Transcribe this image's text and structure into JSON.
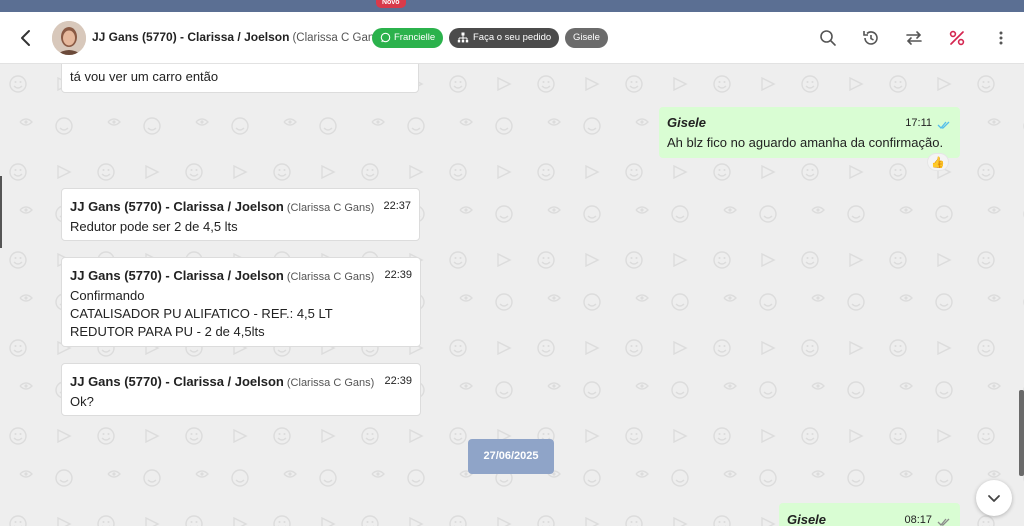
{
  "top_badge": "Novo",
  "header": {
    "contact_name": "JJ Gans (5770) - Clarissa / Joelson",
    "contact_sub": "(Clarissa C Gans)",
    "chips": {
      "whatsapp": "Francielle",
      "order": "Faça o seu pedido",
      "agent": "Gisele"
    },
    "icons": [
      "search-icon",
      "history-icon",
      "transfer-icon",
      "percent-icon",
      "more-vertical-icon"
    ]
  },
  "messages": {
    "m0": {
      "body": "tá vou ver um carro então"
    },
    "m1": {
      "sender": "Gisele",
      "time": "17:11",
      "body": "Ah blz fico no aguardo amanha da confirmação.",
      "reaction": "👍"
    },
    "m2": {
      "sender": "JJ Gans (5770) - Clarissa / Joelson",
      "sender_sub": "(Clarissa C Gans)",
      "time": "22:37",
      "body": "Redutor pode ser 2 de 4,5 lts"
    },
    "m3": {
      "sender": "JJ Gans (5770) - Clarissa / Joelson",
      "sender_sub": "(Clarissa C Gans)",
      "time": "22:39",
      "lines": [
        "Confirmando",
        "CATALISADOR PU ALIFATICO - REF.: 4,5 LT",
        "REDUTOR PARA PU - 2 de 4,5lts"
      ]
    },
    "m4": {
      "sender": "JJ Gans (5770) - Clarissa / Joelson",
      "sender_sub": "(Clarissa C Gans)",
      "time": "22:39",
      "body": "Ok?"
    },
    "date_separator": "27/06/2025",
    "m5": {
      "sender": "Gisele",
      "time": "08:17"
    }
  },
  "colors": {
    "outgoing_bubble": "#d9fdd3",
    "whatsapp_green": "#2bb24c",
    "top_bar": "#5b6f93",
    "date_pill": "#8fa4c8"
  }
}
